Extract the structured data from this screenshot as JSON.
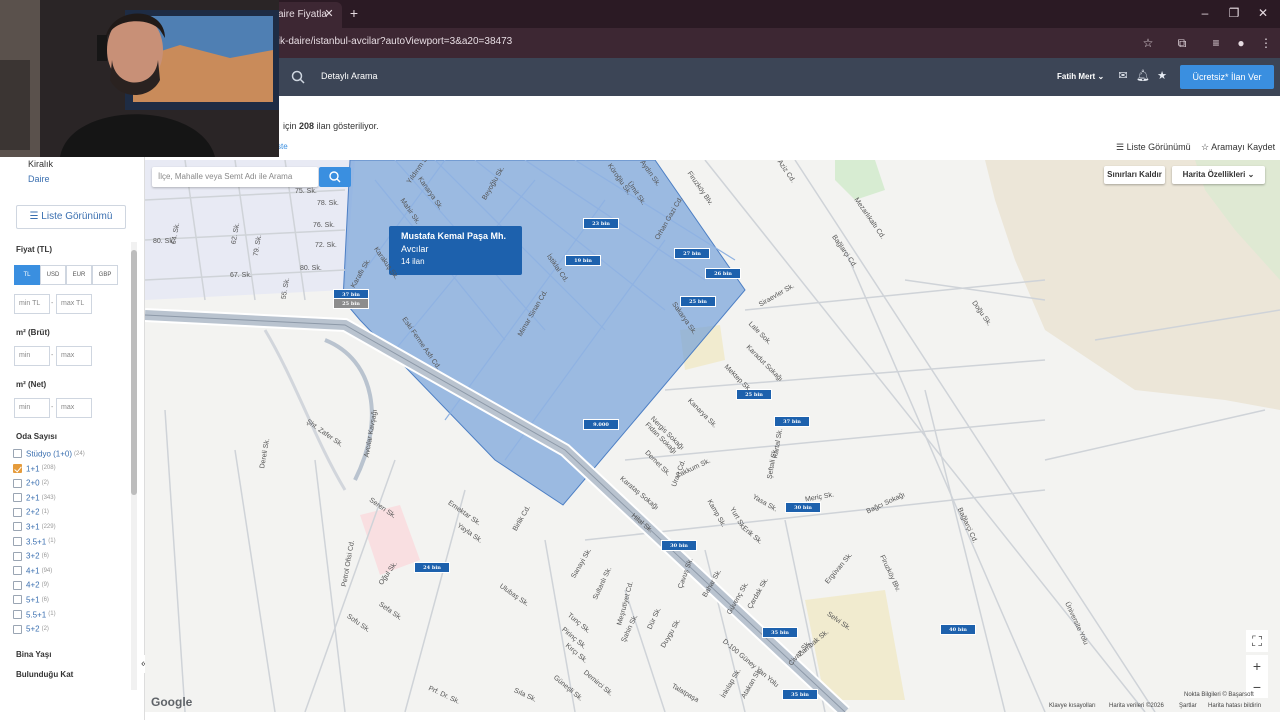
{
  "browser": {
    "tab_title": "aire Fiyatla",
    "url": "alik-daire/istanbul-avcilar?autoViewport=3&a20=38473"
  },
  "header": {
    "detail_search": "Detaylı Arama",
    "user_name": "Fatih Mert",
    "post_button": "Ücretsiz* İlan Ver"
  },
  "results": {
    "prefix": "için",
    "count": "208",
    "suffix": "ilan gösteriliyor.",
    "partial_link": "ste"
  },
  "top_links": {
    "list_view": "Liste Görünümü",
    "save_search": "Aramayı Kaydet"
  },
  "sidebar": {
    "categories": [
      "Kiralık",
      "Daire"
    ],
    "list_view_button": "Liste Görünümü",
    "price_heading": "Fiyat (TL)",
    "currencies": [
      "TL",
      "USD",
      "EUR",
      "GBP"
    ],
    "active_currency": "TL",
    "min_tl": "min TL",
    "max_tl": "max TL",
    "gross_m2": "m² (Brüt)",
    "net_m2": "m² (Net)",
    "min": "min",
    "max": "max",
    "dash": "-",
    "rooms_heading": "Oda Sayısı",
    "rooms": [
      {
        "label": "Stüdyo (1+0)",
        "count": "(24)",
        "checked": false
      },
      {
        "label": "1+1",
        "count": "(208)",
        "checked": true
      },
      {
        "label": "2+0",
        "count": "(2)",
        "checked": false
      },
      {
        "label": "2+1",
        "count": "(343)",
        "checked": false
      },
      {
        "label": "2+2",
        "count": "(1)",
        "checked": false
      },
      {
        "label": "3+1",
        "count": "(229)",
        "checked": false
      },
      {
        "label": "3.5+1",
        "count": "(1)",
        "checked": false
      },
      {
        "label": "3+2",
        "count": "(6)",
        "checked": false
      },
      {
        "label": "4+1",
        "count": "(94)",
        "checked": false
      },
      {
        "label": "4+2",
        "count": "(9)",
        "checked": false
      },
      {
        "label": "5+1",
        "count": "(6)",
        "checked": false
      },
      {
        "label": "5.5+1",
        "count": "(1)",
        "checked": false
      },
      {
        "label": "5+2",
        "count": "(2)",
        "checked": false
      }
    ],
    "building_age": "Bina Yaşı",
    "floor": "Bulunduğu Kat",
    "collapse": "«"
  },
  "map": {
    "search_placeholder": "İlçe, Mahalle veya Semt Adı ile Arama",
    "remove_bounds": "Sınırları Kaldır",
    "map_features": "Harita Özellikleri",
    "popup": {
      "title": "Mustafa Kemal Paşa Mh.",
      "district": "Avcılar",
      "count": "14 ilan"
    },
    "price_tags": [
      "37 bin",
      "25 bin",
      "23 bin",
      "19 bin",
      "27 bin",
      "26 bin",
      "25 bin",
      "25 bin",
      "37 bin",
      "9.000",
      "30 bin",
      "30 bin",
      "24 bin",
      "35 bin",
      "40 bin",
      "35 bin"
    ],
    "streets": [
      "Yıldırım Sk.",
      "Kanarya Sk.",
      "Mahir Sk.",
      "Karakuş Sk.",
      "İstiklal Cd.",
      "Beyoğlu Sk.",
      "Mimar Sinan Cd.",
      "Köroğlu Sk.",
      "Ümit Sk.",
      "Aydın Sk.",
      "Orhan Gazi Cd.",
      "Sakarya Sk.",
      "Firuzköy Blv.",
      "Aziz Cd.",
      "Mezarlıkaltı Cd.",
      "Bağlarçi Cd.",
      "Doğu Sk.",
      "Siraevler Sk.",
      "Lale Sok.",
      "Karadut Sokağı",
      "Mektep Sk.",
      "Uran Cd.",
      "Kanarya Sk.",
      "Nergis Sokağı",
      "Demet Sk.",
      "Fidan Sokağı",
      "Zakkum Sk.",
      "Karataş Sokağı",
      "Hilal Sk.",
      "Eski Ferme Asfı Cd.",
      "Karaflı Sk.",
      "Şht. Zafer Sk.",
      "Avcılar Kavşağı",
      "Dereli Sk.",
      "Seren Sk.",
      "Birlik Cd.",
      "Petrol Ofisi Cd.",
      "Oğul Sk.",
      "Sefa Sk.",
      "Sofu Sk.",
      "Ulubaş Sk.",
      "Sanayi Sk.",
      "Yayla Sk.",
      "Emektar Sk.",
      "Meşrutiyet Cd.",
      "Firuzköy Blv.",
      "Bağlarçi Cd.",
      "Üniversite Yolu",
      "Bağcı Sokağı",
      "Ergüvan Sk.",
      "Selvi Sk.",
      "D-100 Güney Yan Yolu",
      "Talatpaşa",
      "Yasa Sk.",
      "Meriç Sk.",
      "Kamp Sk.",
      "Yurt Sk.",
      "Erik Sk.",
      "Çavuş Sk.",
      "Çardak Sk.",
      "Bahar Sk.",
      "Güvenç Sk.",
      "Zambak Sk.",
      "Civan Sk.",
      "Duygu Sk.",
      "İnkılap Sk.",
      "Atakan Sk.",
      "Demirci Sk.",
      "Güneşli Sk.",
      "Sıla Sk.",
      "Prf. Dr. Sk.",
      "Tunç Sk.",
      "Pirinç Sk.",
      "Kırçı Sk.",
      "Sultanlı Sk.",
      "Şahin Sk.",
      "Dür Sk.",
      "Şeftali Sk.",
      "Kartal Sk.",
      "64. Sk.",
      "62. Sk.",
      "67. Sk.",
      "76. Sk.",
      "80. Sk.",
      "75. Sk.",
      "78. Sk.",
      "72. Sk.",
      "55. Sk.",
      "79. Sk.",
      "80. Sk."
    ],
    "zoom_in": "+",
    "zoom_out": "−",
    "fullscreen": "⛶",
    "google": "Google",
    "attribution": "Nokta Bilgileri © Başarsoft",
    "footer_items": [
      "Klavye kısayolları",
      "Harita verileri ©2026",
      "Şartlar",
      "Harita hatası bildirin"
    ]
  }
}
